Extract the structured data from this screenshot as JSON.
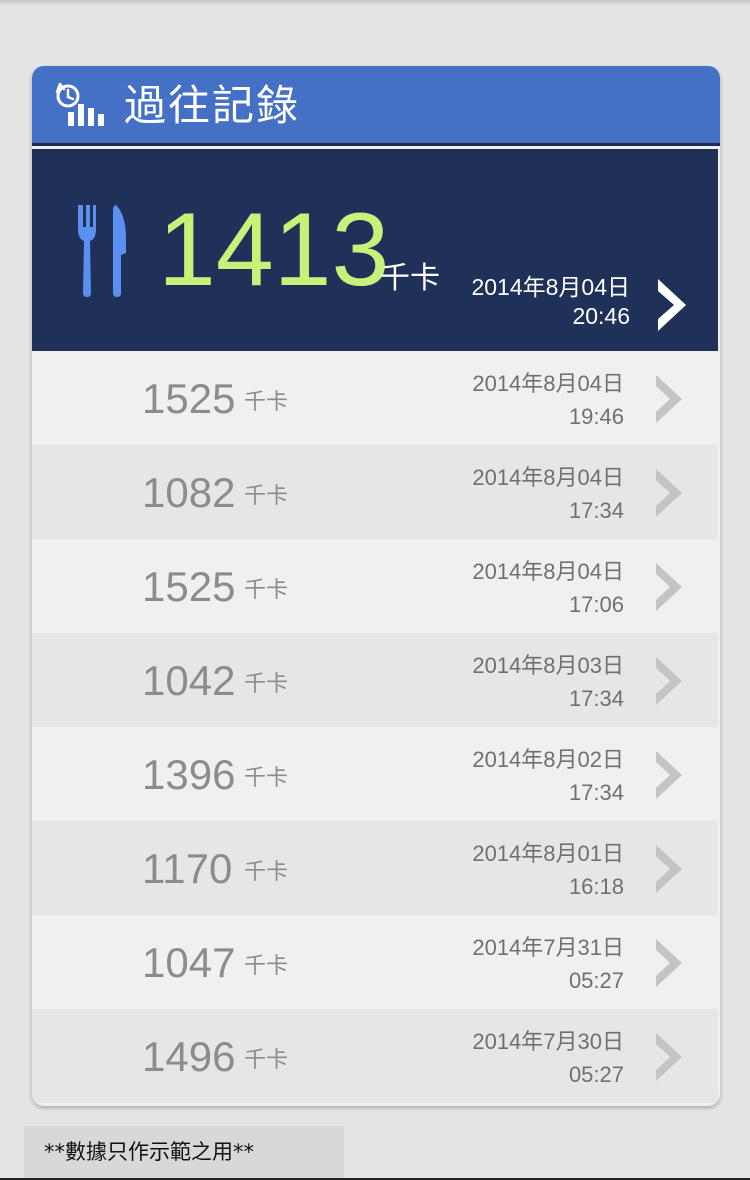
{
  "header": {
    "title": "過往記錄",
    "icon": "history-chart-icon"
  },
  "latest": {
    "value": "1413",
    "unit": "千卡",
    "date": "2014年8月04日",
    "time": "20:46",
    "icon": "cutlery-icon",
    "value_color": "#c7f27a"
  },
  "history": [
    {
      "value": "1525",
      "unit": "千卡",
      "date": "2014年8月04日",
      "time": "19:46"
    },
    {
      "value": "1082",
      "unit": "千卡",
      "date": "2014年8月04日",
      "time": "17:34"
    },
    {
      "value": "1525",
      "unit": "千卡",
      "date": "2014年8月04日",
      "time": "17:06"
    },
    {
      "value": "1042",
      "unit": "千卡",
      "date": "2014年8月03日",
      "time": "17:34"
    },
    {
      "value": "1396",
      "unit": "千卡",
      "date": "2014年8月02日",
      "time": "17:34"
    },
    {
      "value": "1170",
      "unit": "千卡",
      "date": "2014年8月01日",
      "time": "16:18"
    },
    {
      "value": "1047",
      "unit": "千卡",
      "date": "2014年7月31日",
      "time": "05:27"
    },
    {
      "value": "1496",
      "unit": "千卡",
      "date": "2014年7月30日",
      "time": "05:27"
    }
  ],
  "footer": {
    "disclaimer": "**數據只作示範之用**"
  },
  "colors": {
    "header_bg": "#4470c6",
    "latest_bg": "#1f3059"
  }
}
